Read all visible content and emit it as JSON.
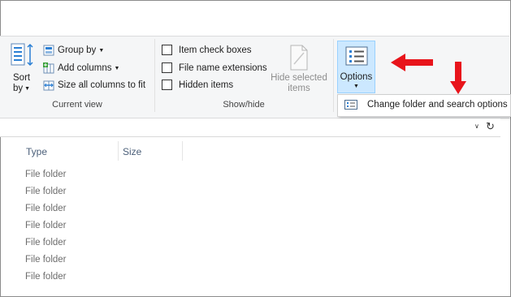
{
  "ribbon": {
    "sort_label_1": "Sort",
    "sort_label_2": "by",
    "group_by": "Group by",
    "add_columns": "Add columns",
    "size_all_columns": "Size all columns to fit",
    "current_view_label": "Current view",
    "item_check_boxes": "Item check boxes",
    "file_name_extensions": "File name extensions",
    "hidden_items": "Hidden items",
    "hide_selected_1": "Hide selected",
    "hide_selected_2": "items",
    "show_hide_label": "Show/hide",
    "options": "Options"
  },
  "dropdown": {
    "change_folder": "Change folder and search options"
  },
  "columns": {
    "type": "Type",
    "size": "Size"
  },
  "rows": [
    {
      "type": "File folder"
    },
    {
      "type": "File folder"
    },
    {
      "type": "File folder"
    },
    {
      "type": "File folder"
    },
    {
      "type": "File folder"
    },
    {
      "type": "File folder"
    },
    {
      "type": "File folder"
    }
  ],
  "colors": {
    "annotation_red": "#e8141b",
    "accent_blue": "#cce8ff",
    "icon_blue": "#2a7fd4"
  }
}
